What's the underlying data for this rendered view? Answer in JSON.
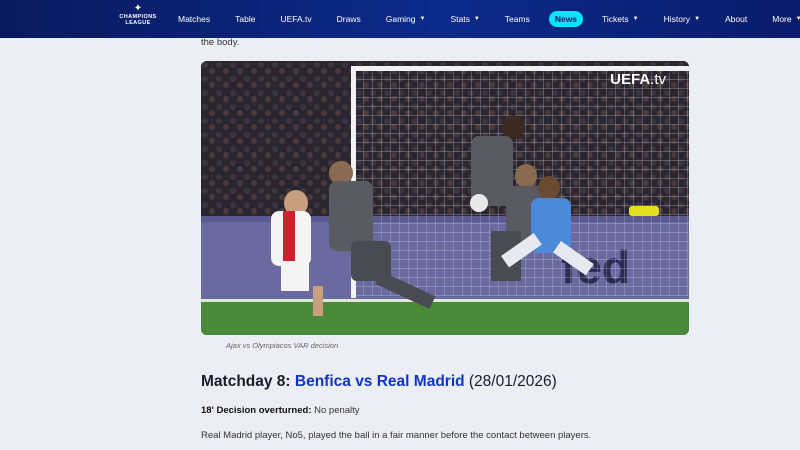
{
  "nav": {
    "logo_line1": "CHAMPIONS",
    "logo_line2": "LEAGUE",
    "items": [
      {
        "label": "Matches",
        "caret": false
      },
      {
        "label": "Table",
        "caret": false
      },
      {
        "label": "UEFA.tv",
        "caret": false
      },
      {
        "label": "Draws",
        "caret": false
      },
      {
        "label": "Gaming",
        "caret": true
      },
      {
        "label": "Stats",
        "caret": true
      },
      {
        "label": "Teams",
        "caret": false
      },
      {
        "label": "News",
        "caret": false,
        "active": true
      },
      {
        "label": "Tickets",
        "caret": true
      },
      {
        "label": "History",
        "caret": true
      },
      {
        "label": "About",
        "caret": false
      },
      {
        "label": "More",
        "caret": true
      }
    ]
  },
  "article": {
    "lead_text": "the body.",
    "video_watermark_brand": "UEFA",
    "video_watermark_suffix": ".tv",
    "video_caption": "Ajax vs Olympiacos VAR decision",
    "section_prefix": "Matchday 8: ",
    "section_link": "Benfica vs Real Madrid",
    "section_suffix": " (28/01/2026)",
    "decision_label": "18' Decision overturned:",
    "decision_value": " No penalty",
    "body_text": "Real Madrid player, No5, played the ball in a fair manner before the contact between players."
  }
}
